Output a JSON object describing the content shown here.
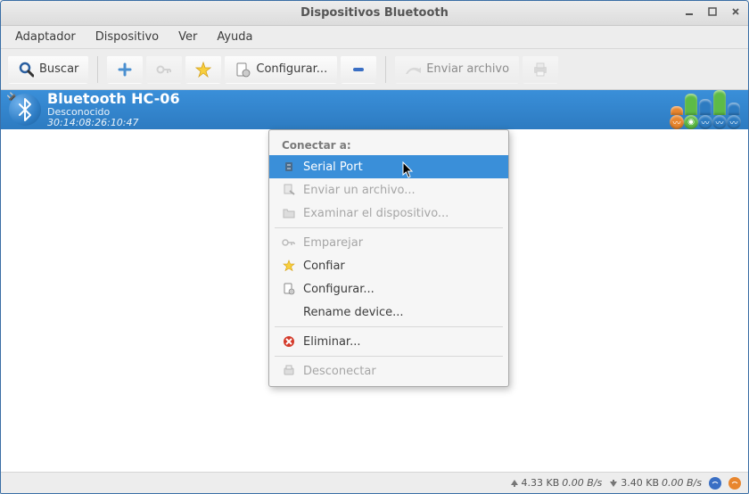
{
  "window": {
    "title": "Dispositivos Bluetooth"
  },
  "menubar": [
    "Adaptador",
    "Dispositivo",
    "Ver",
    "Ayuda"
  ],
  "toolbar": {
    "search": "Buscar",
    "configure": "Configurar...",
    "send_file": "Enviar archivo"
  },
  "device": {
    "name": "Bluetooth HC-06",
    "subtitle": "Desconocido",
    "mac": "30:14:08:26:10:47"
  },
  "context": {
    "header": "Conectar a:",
    "serial_port": "Serial Port",
    "send_file": "Enviar un archivo...",
    "browse": "Examinar el dispositivo...",
    "pair": "Emparejar",
    "trust": "Confiar",
    "configure": "Configurar...",
    "rename": "Rename device...",
    "delete": "Eliminar...",
    "disconnect": "Desconectar"
  },
  "status": {
    "up_total": "4.33 KB",
    "up_rate": "0.00 B/s",
    "down_total": "3.40 KB",
    "down_rate": "0.00 B/s"
  }
}
